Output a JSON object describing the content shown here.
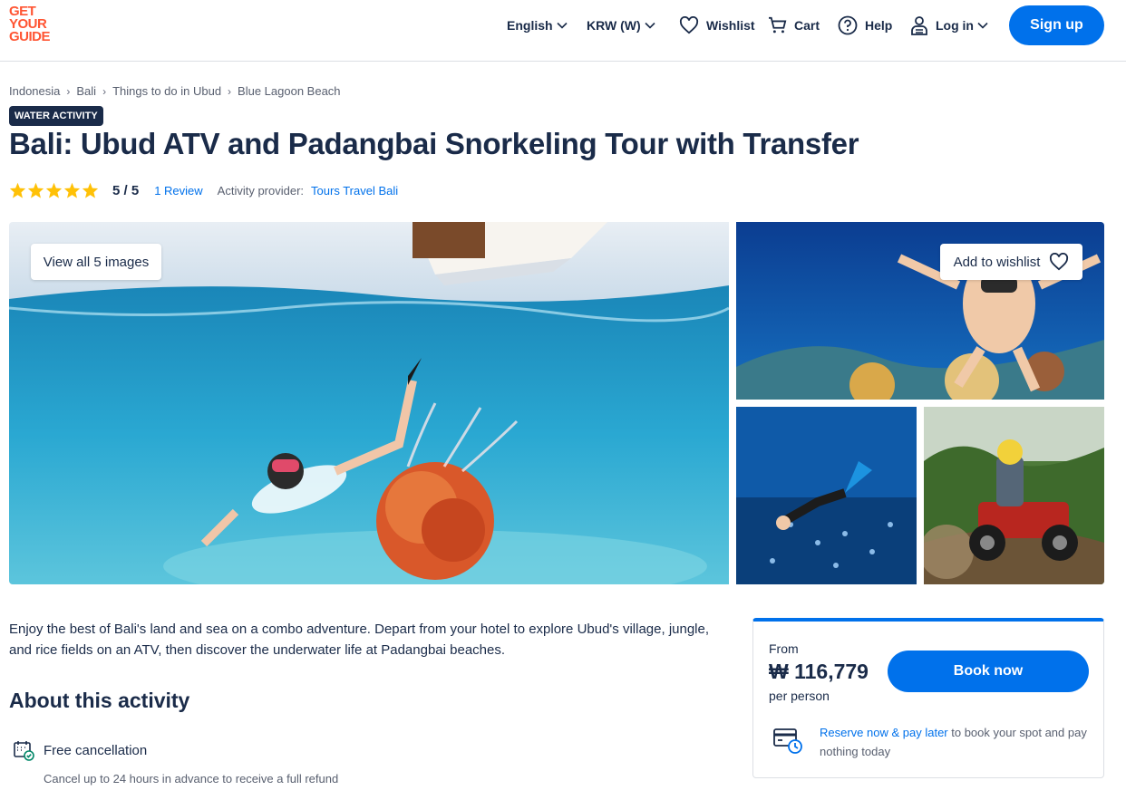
{
  "header": {
    "logo_lines": [
      "GET",
      "YOUR",
      "GUIDE"
    ],
    "language": "English",
    "currency": "KRW (W)",
    "wishlist": "Wishlist",
    "cart": "Cart",
    "help": "Help",
    "login": "Log in",
    "signup": "Sign up"
  },
  "breadcrumb": [
    "Indonesia",
    "Bali",
    "Things to do in Ubud",
    "Blue Lagoon Beach"
  ],
  "badge": "WATER ACTIVITY",
  "title": "Bali: Ubud ATV and Padangbai Snorkeling Tour with Transfer",
  "rating": {
    "stars": 5,
    "score": "5 / 5",
    "reviews": "1 Review",
    "provider_label": "Activity provider:",
    "provider": "Tours Travel Bali"
  },
  "gallery": {
    "view_all": "View all 5 images",
    "add_to_wishlist": "Add to wishlist"
  },
  "description": "Enjoy the best of Bali's land and sea on a combo adventure. Depart from your hotel to explore Ubud's village, jungle, and rice fields on an ATV, then discover the underwater life at Padangbai beaches.",
  "about": {
    "heading": "About this activity",
    "features": [
      {
        "title": "Free cancellation",
        "subtitle": "Cancel up to 24 hours in advance to receive a full refund",
        "icon": "calendar-check-icon"
      }
    ]
  },
  "booking": {
    "from": "From",
    "price": "₩ 116,779",
    "per": "per person",
    "book_now": "Book now",
    "reserve_link": "Reserve now & pay later",
    "reserve_rest": " to book your spot and pay nothing today"
  },
  "colors": {
    "brand": "#ff5533",
    "accent": "#0071eb",
    "navy": "#1a2b49",
    "star": "#ffc107"
  }
}
